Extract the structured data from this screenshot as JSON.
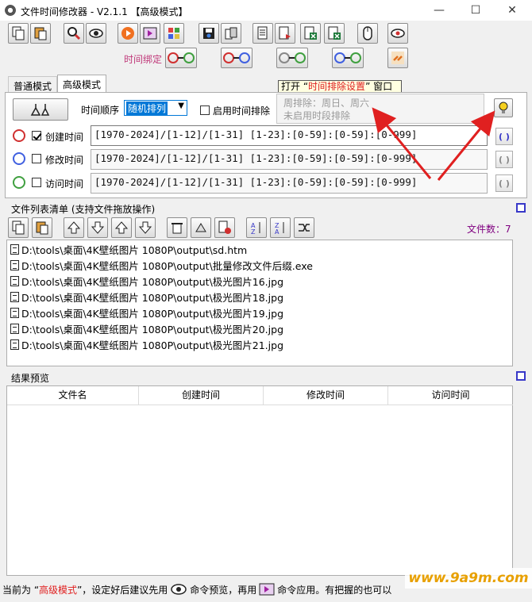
{
  "window": {
    "title": "文件时间修改器    - V2.1.1 【高级模式】",
    "min": "—",
    "max": "☐",
    "close": "✕"
  },
  "toolbar": {
    "bind_label": "时间绑定"
  },
  "tabs": [
    {
      "label": "普通模式"
    },
    {
      "label": "高级模式"
    }
  ],
  "tooltip": {
    "prefix": "打开 “",
    "highlight": "时间排除设置",
    "suffix": "” 窗口"
  },
  "advanced": {
    "order_label": "时间顺序",
    "order_value": "随机排列",
    "exclude_label": "启用时间排除",
    "exclude_info_1": "周排除：周日、周六",
    "exclude_info_2": "未启用时段排除",
    "rows": [
      {
        "label": "创建时间",
        "checked": true,
        "value": "[1970-2024]/[1-12]/[1-31] [1-23]:[0-59]:[0-59]:[0-999]"
      },
      {
        "label": "修改时间",
        "checked": false,
        "value": "[1970-2024]/[1-12]/[1-31] [1-23]:[0-59]:[0-59]:[0-999]"
      },
      {
        "label": "访问时间",
        "checked": false,
        "value": "[1970-2024]/[1-12]/[1-31] [1-23]:[0-59]:[0-59]:[0-999]"
      }
    ]
  },
  "filelist": {
    "title": "文件列表清单 (支持文件拖放操作)",
    "count_label": "文件数：7",
    "items": [
      "D:\\tools\\桌面\\4K壁纸图片 1080P\\output\\sd.htm",
      "D:\\tools\\桌面\\4K壁纸图片 1080P\\output\\批量修改文件后缀.exe",
      "D:\\tools\\桌面\\4K壁纸图片 1080P\\output\\极光图片16.jpg",
      "D:\\tools\\桌面\\4K壁纸图片 1080P\\output\\极光图片18.jpg",
      "D:\\tools\\桌面\\4K壁纸图片 1080P\\output\\极光图片19.jpg",
      "D:\\tools\\桌面\\4K壁纸图片 1080P\\output\\极光图片20.jpg",
      "D:\\tools\\桌面\\4K壁纸图片 1080P\\output\\极光图片21.jpg"
    ]
  },
  "preview": {
    "title": "结果预览",
    "columns": [
      "文件名",
      "创建时间",
      "修改时间",
      "访问时间"
    ]
  },
  "status": {
    "p1": "当前为 “",
    "mode": "高级模式",
    "p2": "”，设定好后建议先用",
    "p3": "命令预览，再用",
    "p4": "命令应用。有把握的也可以"
  },
  "watermark": "www.9a9m.com",
  "colors": {
    "accent_red": "#e02020",
    "pink_label": "#c0397a",
    "count_purple": "#800080"
  }
}
